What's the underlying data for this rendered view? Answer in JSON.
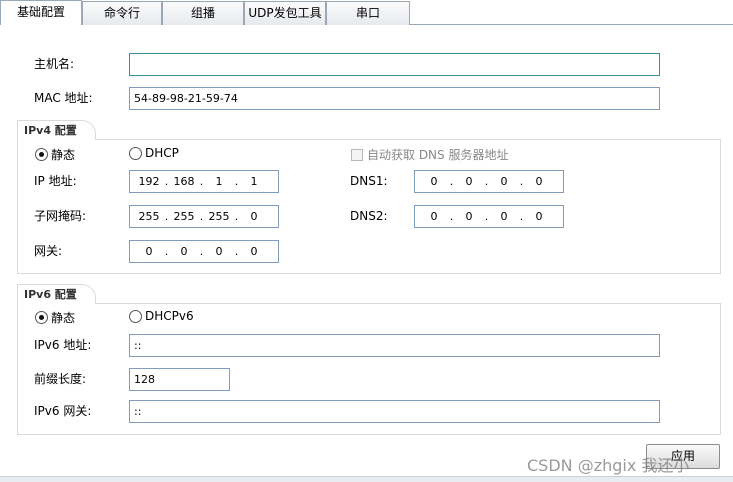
{
  "tabs": [
    {
      "label": "基础配置",
      "active": true
    },
    {
      "label": "命令行",
      "active": false
    },
    {
      "label": "组播",
      "active": false
    },
    {
      "label": "UDP发包工具",
      "active": false
    },
    {
      "label": "串口",
      "active": false
    }
  ],
  "basic": {
    "hostname_label": "主机名:",
    "hostname_value": "",
    "mac_label": "MAC 地址:",
    "mac_value": "54-89-98-21-59-74"
  },
  "ipv4": {
    "section_title": "IPv4 配置",
    "static_label": "静态",
    "dhcp_label": "DHCP",
    "auto_dns_label": "自动获取 DNS 服务器地址",
    "ip_label": "IP 地址:",
    "ip": [
      "192",
      "168",
      "1",
      "1"
    ],
    "mask_label": "子网掩码:",
    "mask": [
      "255",
      "255",
      "255",
      "0"
    ],
    "gateway_label": "网关:",
    "gateway": [
      "0",
      "0",
      "0",
      "0"
    ],
    "dns1_label": "DNS1:",
    "dns1": [
      "0",
      "0",
      "0",
      "0"
    ],
    "dns2_label": "DNS2:",
    "dns2": [
      "0",
      "0",
      "0",
      "0"
    ],
    "mode": "static"
  },
  "ipv6": {
    "section_title": "IPv6 配置",
    "static_label": "静态",
    "dhcp_label": "DHCPv6",
    "addr_label": "IPv6 地址:",
    "addr_value": "::",
    "prefix_label": "前缀长度:",
    "prefix_value": "128",
    "gateway_label": "IPv6 网关:",
    "gateway_value": "::",
    "mode": "static"
  },
  "apply_label": "应用",
  "watermark": "CSDN @zhgix  我还小"
}
